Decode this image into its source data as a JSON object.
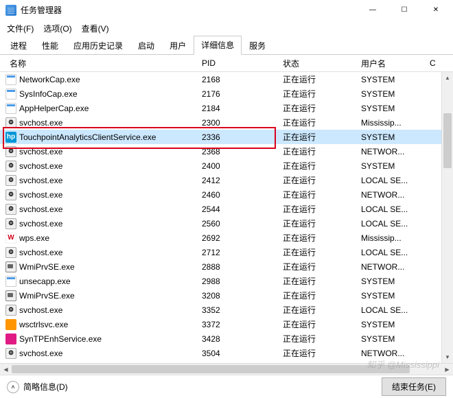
{
  "window": {
    "title": "任务管理器"
  },
  "menus": [
    {
      "label": "文件(F)"
    },
    {
      "label": "选项(O)"
    },
    {
      "label": "查看(V)"
    }
  ],
  "tabs": [
    {
      "label": "进程",
      "active": false
    },
    {
      "label": "性能",
      "active": false
    },
    {
      "label": "应用历史记录",
      "active": false
    },
    {
      "label": "启动",
      "active": false
    },
    {
      "label": "用户",
      "active": false
    },
    {
      "label": "详细信息",
      "active": true
    },
    {
      "label": "服务",
      "active": false
    }
  ],
  "columns": {
    "name": "名称",
    "pid": "PID",
    "status": "状态",
    "user": "用户名",
    "last": "C"
  },
  "processes": [
    {
      "icon": "win",
      "name": "NetworkCap.exe",
      "pid": "2168",
      "status": "正在运行",
      "user": "SYSTEM"
    },
    {
      "icon": "win",
      "name": "SysInfoCap.exe",
      "pid": "2176",
      "status": "正在运行",
      "user": "SYSTEM"
    },
    {
      "icon": "win",
      "name": "AppHelperCap.exe",
      "pid": "2184",
      "status": "正在运行",
      "user": "SYSTEM"
    },
    {
      "icon": "gear",
      "name": "svchost.exe",
      "pid": "2300",
      "status": "正在运行",
      "user": "Mississip..."
    },
    {
      "icon": "hp",
      "name": "TouchpointAnalyticsClientService.exe",
      "pid": "2336",
      "status": "正在运行",
      "user": "SYSTEM",
      "selected": true
    },
    {
      "icon": "gear",
      "name": "svchost.exe",
      "pid": "2368",
      "status": "正在运行",
      "user": "NETWOR..."
    },
    {
      "icon": "gear",
      "name": "svchost.exe",
      "pid": "2400",
      "status": "正在运行",
      "user": "SYSTEM"
    },
    {
      "icon": "gear",
      "name": "svchost.exe",
      "pid": "2412",
      "status": "正在运行",
      "user": "LOCAL SE..."
    },
    {
      "icon": "gear",
      "name": "svchost.exe",
      "pid": "2460",
      "status": "正在运行",
      "user": "NETWOR..."
    },
    {
      "icon": "gear",
      "name": "svchost.exe",
      "pid": "2544",
      "status": "正在运行",
      "user": "LOCAL SE..."
    },
    {
      "icon": "gear",
      "name": "svchost.exe",
      "pid": "2560",
      "status": "正在运行",
      "user": "LOCAL SE..."
    },
    {
      "icon": "wps",
      "name": "wps.exe",
      "pid": "2692",
      "status": "正在运行",
      "user": "Mississip..."
    },
    {
      "icon": "gear",
      "name": "svchost.exe",
      "pid": "2712",
      "status": "正在运行",
      "user": "LOCAL SE..."
    },
    {
      "icon": "wmi",
      "name": "WmiPrvSE.exe",
      "pid": "2888",
      "status": "正在运行",
      "user": "NETWOR..."
    },
    {
      "icon": "win",
      "name": "unsecapp.exe",
      "pid": "2988",
      "status": "正在运行",
      "user": "SYSTEM"
    },
    {
      "icon": "wmi",
      "name": "WmiPrvSE.exe",
      "pid": "3208",
      "status": "正在运行",
      "user": "SYSTEM"
    },
    {
      "icon": "gear",
      "name": "svchost.exe",
      "pid": "3352",
      "status": "正在运行",
      "user": "LOCAL SE..."
    },
    {
      "icon": "orange",
      "name": "wsctrlsvc.exe",
      "pid": "3372",
      "status": "正在运行",
      "user": "SYSTEM"
    },
    {
      "icon": "syn",
      "name": "SynTPEnhService.exe",
      "pid": "3428",
      "status": "正在运行",
      "user": "SYSTEM"
    },
    {
      "icon": "gear",
      "name": "svchost.exe",
      "pid": "3504",
      "status": "正在运行",
      "user": "NETWOR..."
    }
  ],
  "footer": {
    "brief": "简略信息(D)",
    "end": "结束任务(E)"
  },
  "watermark": "知乎 @Mississippi",
  "icon_text": {
    "hp": "hp",
    "wps": "W"
  }
}
